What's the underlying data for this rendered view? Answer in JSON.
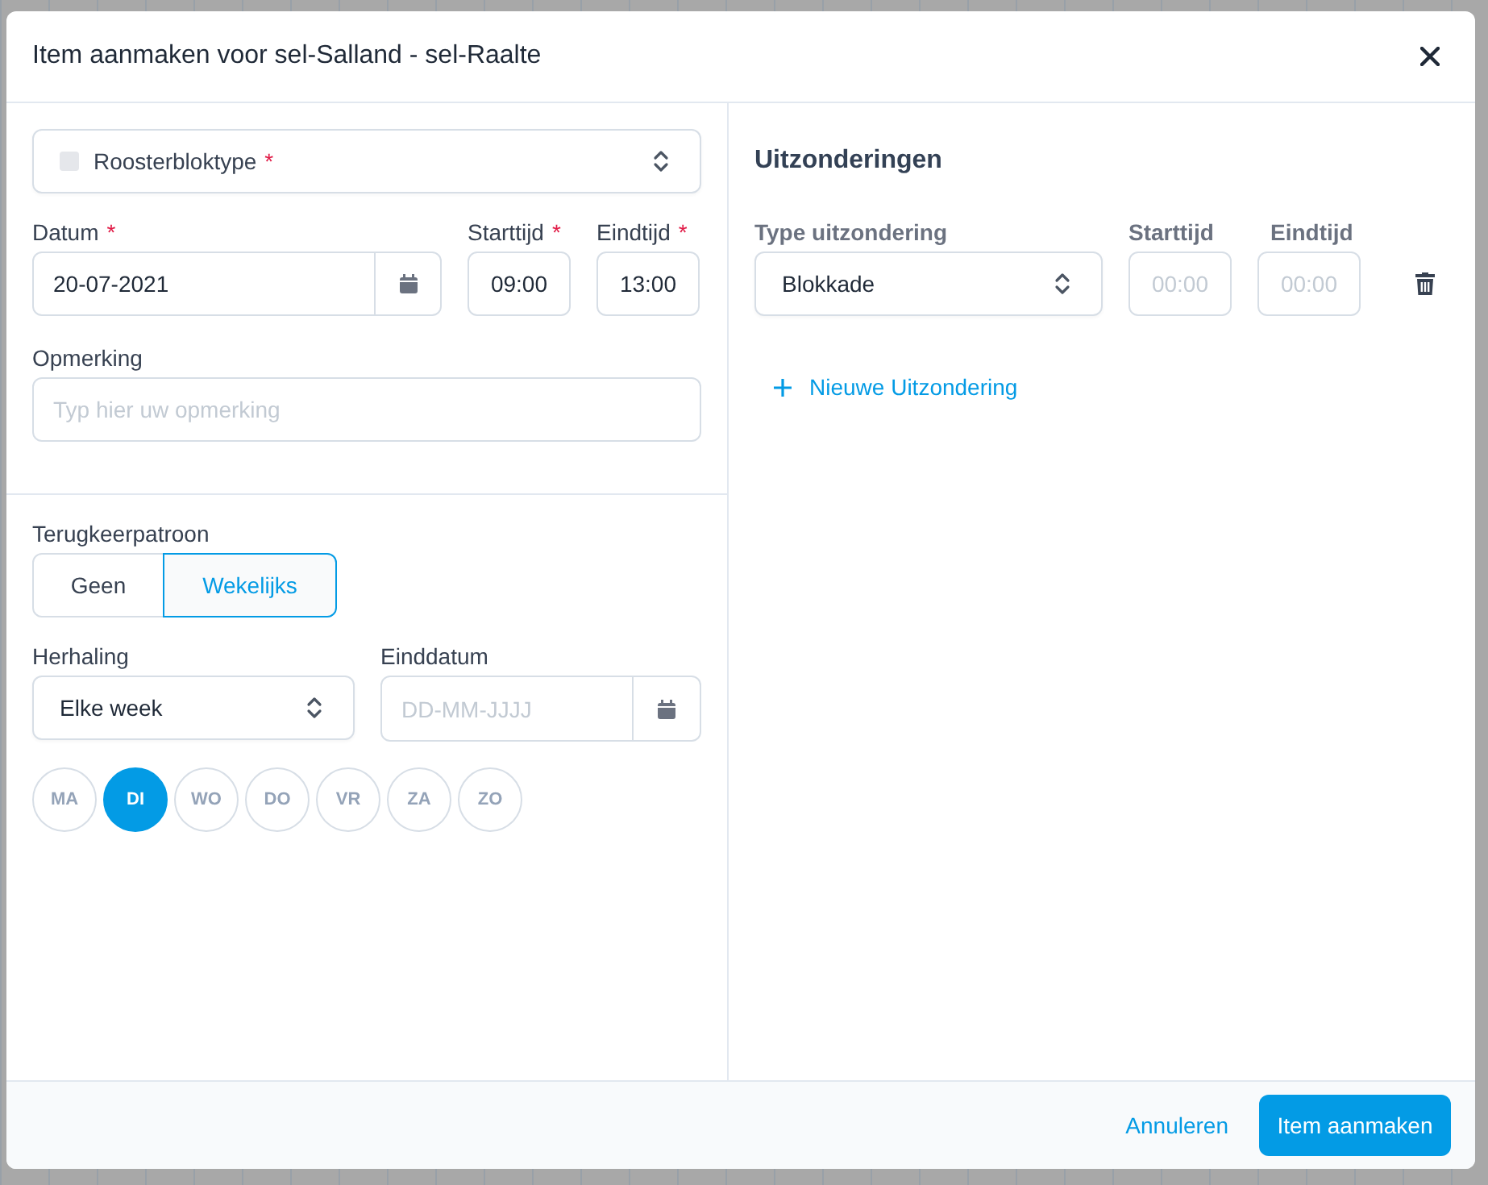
{
  "dialog": {
    "title": "Item aanmaken voor sel-Salland - sel-Raalte"
  },
  "schedule_block_type": {
    "label": "Roosterbloktype",
    "required_mark": "*"
  },
  "date_fields": [
    {
      "kind": "date",
      "label": "Datum",
      "required_mark": "*",
      "value": "20-07-2021"
    },
    {
      "kind": "time",
      "label": "Starttijd",
      "required_mark": "*",
      "value": "09:00"
    },
    {
      "kind": "time",
      "label": "Eindtijd",
      "required_mark": "*",
      "value": "13:00"
    }
  ],
  "remark": {
    "label": "Opmerking",
    "placeholder": "Typ hier uw opmerking"
  },
  "recurrence": {
    "label": "Terugkeerpatroon",
    "options": [
      {
        "label": "Geen",
        "selected": false
      },
      {
        "label": "Wekelijks",
        "selected": true
      }
    ]
  },
  "repeat": {
    "label": "Herhaling",
    "value": "Elke week"
  },
  "end_date": {
    "label": "Einddatum",
    "placeholder": "DD-MM-JJJJ"
  },
  "weekdays": [
    {
      "label": "MA",
      "selected": false
    },
    {
      "label": "DI",
      "selected": true
    },
    {
      "label": "WO",
      "selected": false
    },
    {
      "label": "DO",
      "selected": false
    },
    {
      "label": "VR",
      "selected": false
    },
    {
      "label": "ZA",
      "selected": false
    },
    {
      "label": "ZO",
      "selected": false
    }
  ],
  "exceptions": {
    "title": "Uitzonderingen",
    "columns": [
      "Type uitzondering",
      "Starttijd",
      "Eindtijd"
    ],
    "rows": [
      {
        "type": "Blokkade",
        "start_placeholder": "00:00",
        "end_placeholder": "00:00"
      }
    ],
    "add_link": "Nieuwe Uitzondering"
  },
  "footer": {
    "buttons": [
      {
        "kind": "link",
        "label": "Annuleren"
      },
      {
        "kind": "primary",
        "label": "Item aanmaken"
      }
    ]
  }
}
